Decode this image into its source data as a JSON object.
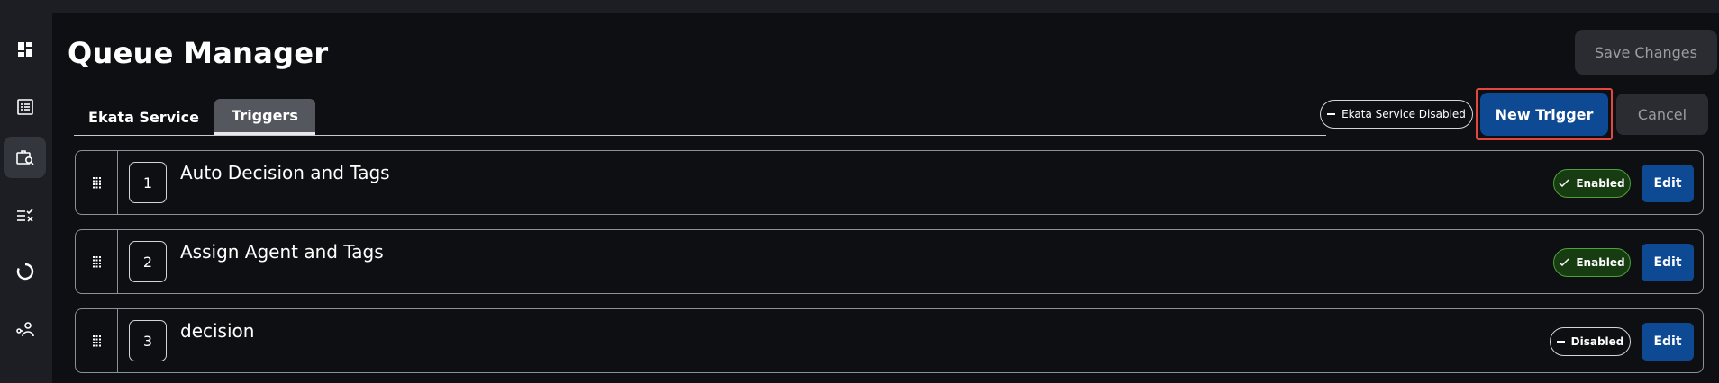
{
  "page": {
    "title": "Queue Manager",
    "save_label": "Save Changes"
  },
  "sidebar": {
    "items": [
      {
        "icon": "dashboard-icon",
        "active": false
      },
      {
        "icon": "list-icon",
        "active": false
      },
      {
        "icon": "briefcase-search-icon",
        "active": true
      },
      {
        "icon": "checklist-icon",
        "active": false
      },
      {
        "icon": "loading-circle-icon",
        "active": false
      },
      {
        "icon": "user-connections-icon",
        "active": false
      }
    ]
  },
  "tabs": [
    {
      "label": "Ekata Service",
      "active": false
    },
    {
      "label": "Triggers",
      "active": true
    }
  ],
  "toolbar": {
    "service_status": "Ekata Service Disabled",
    "new_trigger_label": "New Trigger",
    "cancel_label": "Cancel"
  },
  "triggers": [
    {
      "number": "1",
      "name": "Auto Decision and Tags",
      "status": "Enabled",
      "edit_label": "Edit"
    },
    {
      "number": "2",
      "name": "Assign Agent and Tags",
      "status": "Enabled",
      "edit_label": "Edit"
    },
    {
      "number": "3",
      "name": "decision",
      "status": "Disabled",
      "edit_label": "Edit"
    }
  ],
  "colors": {
    "background": "#0e0f13",
    "sidebar": "#1c1e24",
    "accent_blue": "#0e4a94",
    "enabled_green": "#4ca23a",
    "focus_red": "#e5473f"
  }
}
